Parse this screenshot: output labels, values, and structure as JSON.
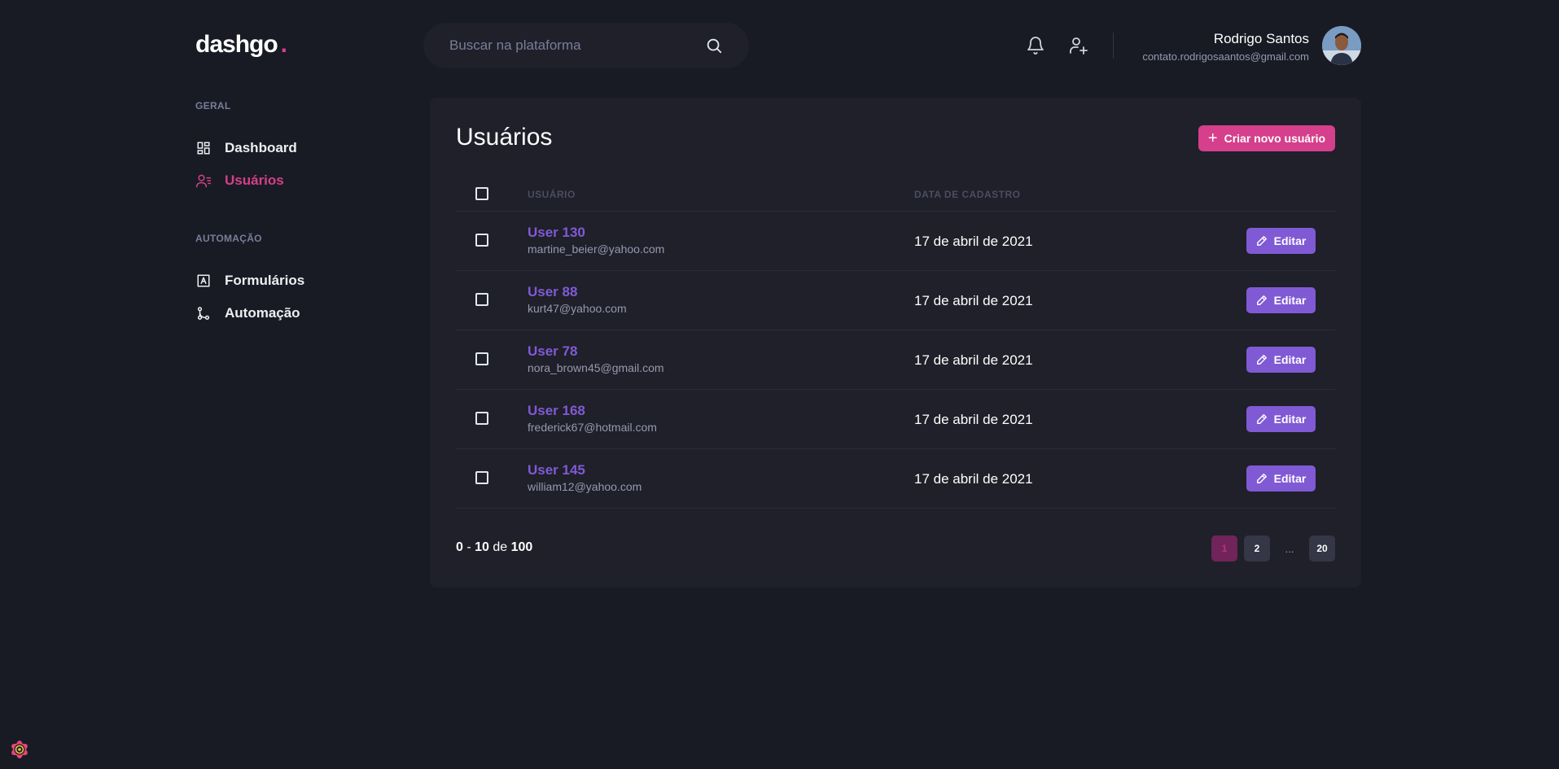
{
  "header": {
    "logo_text": "dashgo",
    "logo_dot": ".",
    "search_placeholder": "Buscar na plataforma",
    "user_name": "Rodrigo Santos",
    "user_email": "contato.rodrigosaantos@gmail.com"
  },
  "sidebar": {
    "sections": [
      {
        "title": "GERAL",
        "items": [
          {
            "label": "Dashboard",
            "icon": "dashboard-icon",
            "active": false
          },
          {
            "label": "Usuários",
            "icon": "users-icon",
            "active": true
          }
        ]
      },
      {
        "title": "AUTOMAÇÃO",
        "items": [
          {
            "label": "Formulários",
            "icon": "form-icon",
            "active": false
          },
          {
            "label": "Automação",
            "icon": "git-merge-icon",
            "active": false
          }
        ]
      }
    ]
  },
  "main": {
    "title": "Usuários",
    "create_button": "Criar novo usuário",
    "columns": [
      "USUÁRIO",
      "DATA DE CADASTRO"
    ],
    "rows": [
      {
        "name": "User 130",
        "email": "martine_beier@yahoo.com",
        "date": "17 de abril de 2021",
        "action": "Editar"
      },
      {
        "name": "User 88",
        "email": "kurt47@yahoo.com",
        "date": "17 de abril de 2021",
        "action": "Editar"
      },
      {
        "name": "User 78",
        "email": "nora_brown45@gmail.com",
        "date": "17 de abril de 2021",
        "action": "Editar"
      },
      {
        "name": "User 168",
        "email": "frederick67@hotmail.com",
        "date": "17 de abril de 2021",
        "action": "Editar"
      },
      {
        "name": "User 145",
        "email": "william12@yahoo.com",
        "date": "17 de abril de 2021",
        "action": "Editar"
      }
    ],
    "pagination": {
      "range_start": "0",
      "range_sep": " - ",
      "range_end": "10",
      "of_word": " de ",
      "total": "100",
      "pages": [
        "1",
        "2"
      ],
      "ellipsis": "...",
      "last_page": "20",
      "current": "1"
    }
  },
  "colors": {
    "background": "#181b23",
    "card": "#1f2029",
    "accent_pink": "#d53f8c",
    "accent_purple": "#805ad5"
  }
}
